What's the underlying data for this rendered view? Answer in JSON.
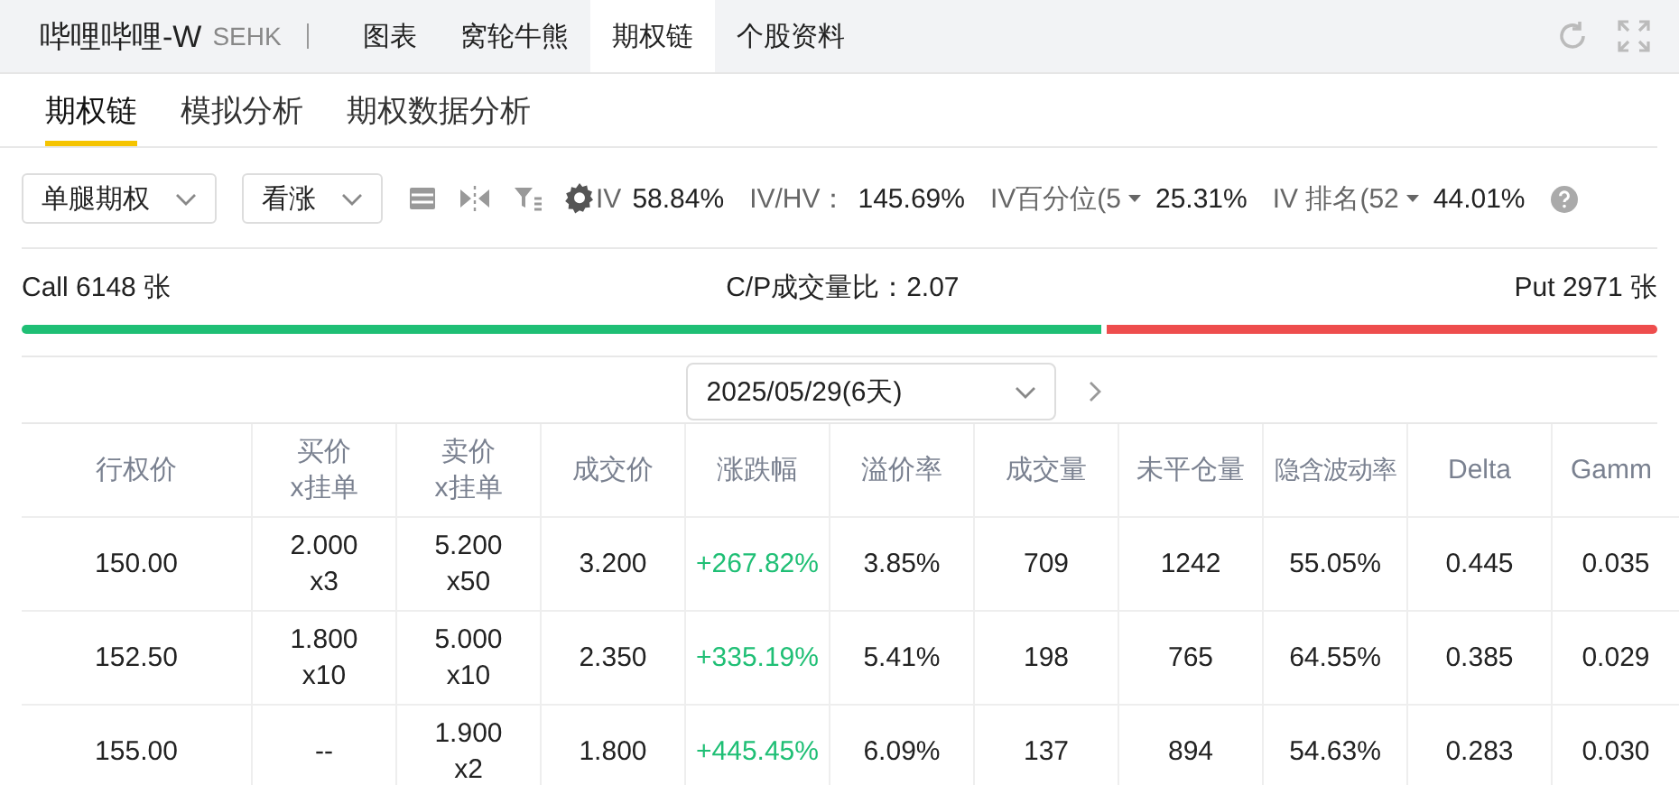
{
  "header": {
    "title": "哔哩哔哩-W",
    "exchange": "SEHK",
    "tabs": [
      {
        "label": "图表",
        "selected": false
      },
      {
        "label": "窝轮牛熊",
        "selected": false
      },
      {
        "label": "期权链",
        "selected": true
      },
      {
        "label": "个股资料",
        "selected": false
      }
    ]
  },
  "subtabs": [
    {
      "label": "期权链",
      "selected": true
    },
    {
      "label": "模拟分析",
      "selected": false
    },
    {
      "label": "期权数据分析",
      "selected": false
    }
  ],
  "toolbar": {
    "dropdowns": [
      "单腿期权",
      "看涨"
    ],
    "stats": [
      {
        "label": "IV",
        "value": "58.84%",
        "kind": "plain"
      },
      {
        "label": "IV/HV：",
        "value": "145.69%",
        "kind": "plain"
      },
      {
        "label": "IV百分位(5",
        "value": "25.31%",
        "kind": "dropdown"
      },
      {
        "label": "IV 排名(52",
        "value": "44.01%",
        "kind": "dropdown"
      }
    ]
  },
  "volume": {
    "call": "Call 6148 张",
    "ratio": "C/P成交量比：2.07",
    "put": "Put 2971 张",
    "level": 0.66
  },
  "expiry": {
    "value": "2025/05/29(6天)"
  },
  "table": {
    "columns": [
      {
        "label": "行权价",
        "kind": "plain"
      },
      {
        "label": "买价\nx挂单",
        "kind": "plain"
      },
      {
        "label": "卖价\nx挂单",
        "kind": "plain"
      },
      {
        "label": "成交价",
        "kind": "plain"
      },
      {
        "label": "涨跌幅",
        "kind": "change"
      },
      {
        "label": "溢价率",
        "kind": "plain"
      },
      {
        "label": "成交量",
        "kind": "plain"
      },
      {
        "label": "未平仓量",
        "kind": "plain"
      },
      {
        "label": "隐含波动率",
        "kind": "plain"
      },
      {
        "label": "Delta",
        "kind": "plain"
      },
      {
        "label": "Gamm",
        "kind": "plain"
      }
    ],
    "rows": [
      [
        "150.00",
        "2.000\nx3",
        "5.200\nx50",
        "3.200",
        "+267.82%",
        "3.85%",
        "709",
        "1242",
        "55.05%",
        "0.445",
        "0.035"
      ],
      [
        "152.50",
        "1.800\nx10",
        "5.000\nx10",
        "2.350",
        "+335.19%",
        "5.41%",
        "198",
        "765",
        "64.55%",
        "0.385",
        "0.029"
      ],
      [
        "155.00",
        "--",
        "1.900\nx2",
        "1.800",
        "+445.45%",
        "6.09%",
        "137",
        "894",
        "54.63%",
        "0.283",
        "0.030"
      ]
    ]
  }
}
